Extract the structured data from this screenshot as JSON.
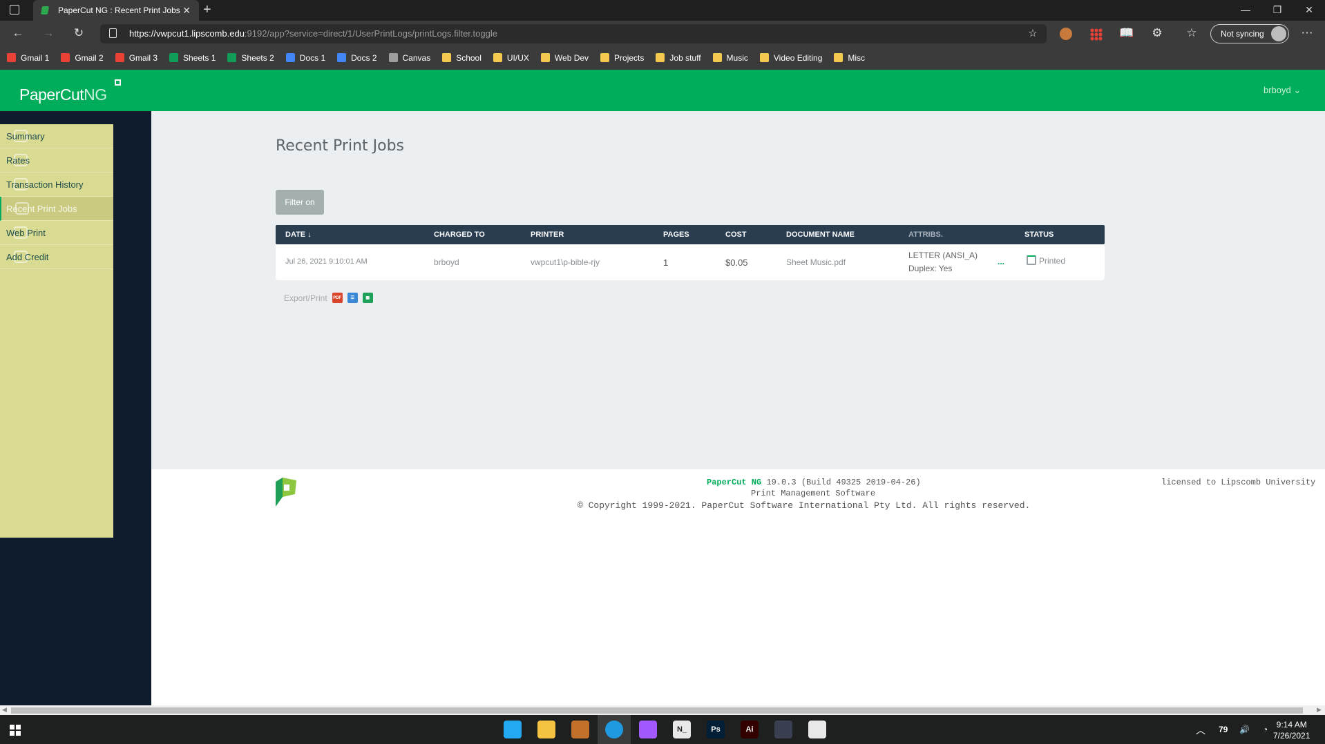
{
  "browser": {
    "tab_title": "PaperCut NG : Recent Print Jobs",
    "url_host": "https://vwpcut1.lipscomb.edu",
    "url_rest": ":9192/app?service=direct/1/UserPrintLogs/printLogs.filter.toggle",
    "sync_label": "Not syncing",
    "bookmarks": [
      {
        "label": "Gmail 1",
        "icon": "gmail-icon",
        "color": "#e94235"
      },
      {
        "label": "Gmail 2",
        "icon": "gmail-icon",
        "color": "#e94235"
      },
      {
        "label": "Gmail 3",
        "icon": "gmail-icon",
        "color": "#e94235"
      },
      {
        "label": "Sheets 1",
        "icon": "sheets-icon",
        "color": "#0f9d58"
      },
      {
        "label": "Sheets 2",
        "icon": "sheets-icon",
        "color": "#0f9d58"
      },
      {
        "label": "Docs 1",
        "icon": "docs-icon",
        "color": "#4285f4"
      },
      {
        "label": "Docs 2",
        "icon": "docs-icon",
        "color": "#4285f4"
      },
      {
        "label": "Canvas",
        "icon": "canvas-icon",
        "color": "#9e9e9e"
      },
      {
        "label": "School",
        "icon": "folder-icon",
        "color": "#f3c94f"
      },
      {
        "label": "UI/UX",
        "icon": "folder-icon",
        "color": "#f3c94f"
      },
      {
        "label": "Web Dev",
        "icon": "folder-icon",
        "color": "#f3c94f"
      },
      {
        "label": "Projects",
        "icon": "folder-icon",
        "color": "#f3c94f"
      },
      {
        "label": "Job stuff",
        "icon": "folder-icon",
        "color": "#f3c94f"
      },
      {
        "label": "Music",
        "icon": "folder-icon",
        "color": "#f3c94f"
      },
      {
        "label": "Video Editing",
        "icon": "folder-icon",
        "color": "#f3c94f"
      },
      {
        "label": "Misc",
        "icon": "folder-icon",
        "color": "#f3c94f"
      }
    ]
  },
  "app": {
    "logo_main": "PaperCut",
    "logo_ng": "NG",
    "user": "brboyd",
    "brand_color": "#00ad5a"
  },
  "sidebar": {
    "items": [
      {
        "label": "Summary",
        "icon": "summary-icon"
      },
      {
        "label": "Rates",
        "icon": "rates-icon"
      },
      {
        "label": "Transaction History",
        "icon": "transaction-icon"
      },
      {
        "label": "Recent Print Jobs",
        "icon": "inbox-icon",
        "active": true
      },
      {
        "label": "Web Print",
        "icon": "printer-icon"
      },
      {
        "label": "Add Credit",
        "icon": "link-icon"
      }
    ]
  },
  "main": {
    "title": "Recent Print Jobs",
    "filter_button": "Filter on",
    "columns": [
      "DATE ↓",
      "CHARGED TO",
      "PRINTER",
      "PAGES",
      "COST",
      "DOCUMENT NAME",
      "ATTRIBS.",
      "STATUS"
    ],
    "rows": [
      {
        "date": "Jul 26, 2021 9:10:01 AM",
        "charged_to": "brboyd",
        "printer": "vwpcut1\\p-bible-rjy",
        "pages": "1",
        "cost": "$0.05",
        "document": "Sheet Music.pdf",
        "attrib_1": "LETTER (ANSI_A)",
        "attrib_2": "Duplex: Yes",
        "more": "...",
        "status": "Printed"
      }
    ],
    "export_label": "Export/Print",
    "export_pdf": "PDF"
  },
  "footer": {
    "product": "PaperCut NG",
    "version": " 19.0.3 (Build 49325 2019-04-26)",
    "subtitle": "Print Management Software",
    "copyright": "© Copyright 1999-2021. PaperCut Software International Pty Ltd. All rights reserved.",
    "license": "licensed to Lipscomb University"
  },
  "taskbar": {
    "apps": [
      {
        "name": "vscode",
        "label": "",
        "color": "#23a9f2"
      },
      {
        "name": "file-explorer",
        "label": "",
        "color": "#f5c342"
      },
      {
        "name": "reaper",
        "label": "",
        "color": "#c2702a"
      },
      {
        "name": "edge",
        "label": "",
        "color": "#1f9ae0"
      },
      {
        "name": "figma",
        "label": "",
        "color": "#a259ff"
      },
      {
        "name": "notepad",
        "label": "N_",
        "color": "#e8e8e8"
      },
      {
        "name": "photoshop",
        "label": "Ps",
        "color": "#001e36"
      },
      {
        "name": "illustrator",
        "label": "Ai",
        "color": "#330000"
      },
      {
        "name": "davinci",
        "label": "",
        "color": "#3b3f52"
      },
      {
        "name": "monitor",
        "label": "",
        "color": "#e8e8e8"
      }
    ],
    "tray_number": "79",
    "time": "9:14 AM",
    "date": "7/26/2021"
  }
}
